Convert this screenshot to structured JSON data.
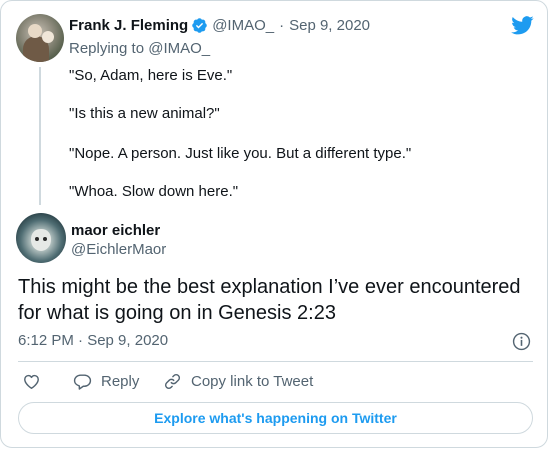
{
  "parent_tweet": {
    "author_name": "Frank J. Fleming",
    "handle": "@IMAO_",
    "separator": "·",
    "date": "Sep 9, 2020",
    "replying_prefix": "Replying to",
    "replying_handle": "@IMAO_",
    "lines": [
      "\"So, Adam, here is Eve.\"",
      "\"Is this a new animal?\"",
      "\"Nope. A person. Just like you. But a different type.\"",
      "\"Whoa. Slow down here.\""
    ]
  },
  "main_tweet": {
    "author_name": "maor eichler",
    "handle": "@EichlerMaor",
    "text": "This might be the best explanation I’ve ever encountered for what is going on in Genesis 2:23",
    "timestamp": "6:12 PM · Sep 9, 2020"
  },
  "actions": {
    "reply_label": "Reply",
    "copy_label": "Copy link to Tweet"
  },
  "explore_label": "Explore what's happening on Twitter",
  "colors": {
    "brand_blue": "#1d9bf0",
    "text": "#0f1419",
    "muted": "#536471",
    "border": "#cfd9de"
  },
  "icons": [
    "twitter-bird-icon",
    "verified-badge-icon",
    "heart-icon",
    "reply-bubble-icon",
    "link-icon",
    "info-icon"
  ]
}
